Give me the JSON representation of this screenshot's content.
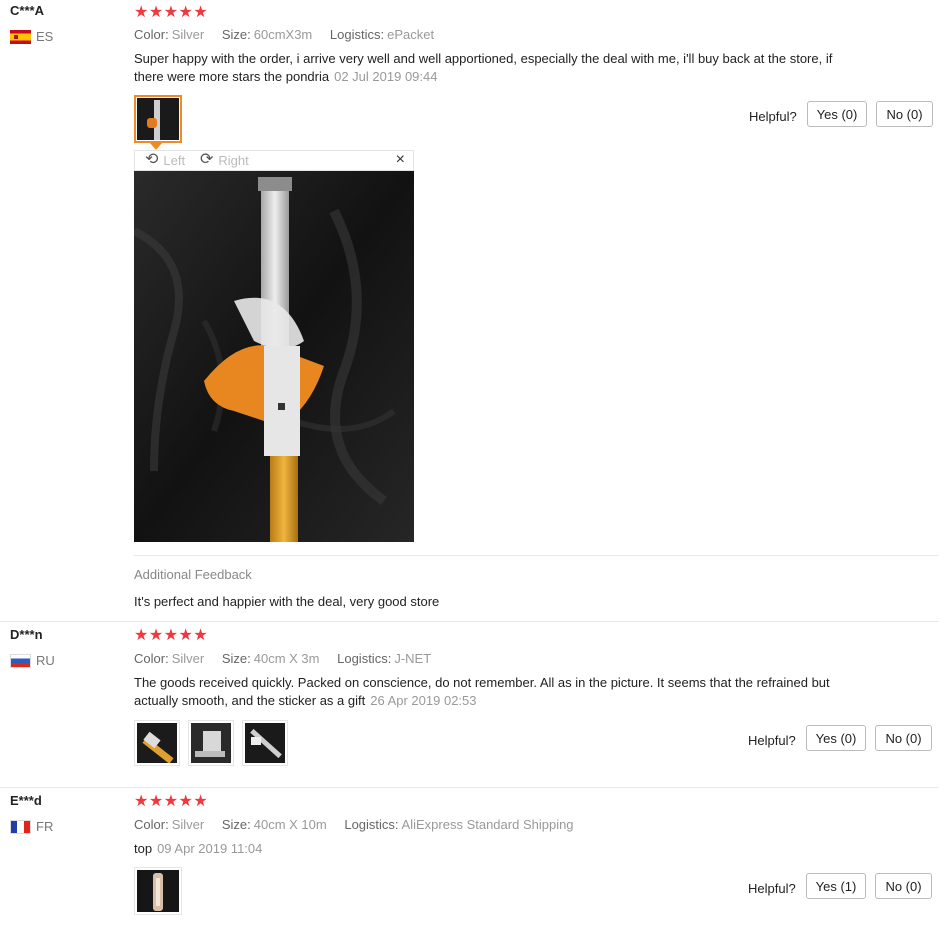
{
  "colors": {
    "star": "#f0393e",
    "active_thumb_border": "#f08a24",
    "muted": "#999999"
  },
  "labels": {
    "color": "Color:",
    "size": "Size:",
    "logistics": "Logistics:",
    "helpful": "Helpful?",
    "star_glyphs": "★★★★★"
  },
  "reviews": [
    {
      "user": "C***A",
      "country": "ES",
      "rating": 5,
      "color": "Silver",
      "size": "60cmX3m",
      "logistics": "ePacket",
      "text": "Super happy with the order, i arrive very well and well apportioned, especially the deal with me, i'll buy back at the store, if there were more stars the pondria",
      "date": "02 Jul 2019 09:44",
      "yes": "Yes (0)",
      "no": "No (0)",
      "viewer": {
        "left": "Left",
        "right": "Right",
        "close": "×",
        "rotate_left_icon": "rotate-left-icon",
        "rotate_right_icon": "rotate-right-icon"
      },
      "additional_feedback_title": "Additional Feedback",
      "additional_feedback_text": "It's perfect and happier with the deal, very good store"
    },
    {
      "user": "D***n",
      "country": "RU",
      "rating": 5,
      "color": "Silver",
      "size": "40cm X 3m",
      "logistics": "J-NET",
      "text": "The goods received quickly. Packed on conscience, do not remember. All as in the picture. It seems that the refrained but actually smooth, and the sticker as a gift",
      "date": "26 Apr 2019 02:53",
      "yes": "Yes (0)",
      "no": "No (0)"
    },
    {
      "user": "E***d",
      "country": "FR",
      "rating": 5,
      "color": "Silver",
      "size": "40cm X 10m",
      "logistics": "AliExpress Standard Shipping",
      "text": "top",
      "date": "09 Apr 2019 11:04",
      "yes": "Yes (1)",
      "no": "No (0)"
    }
  ]
}
